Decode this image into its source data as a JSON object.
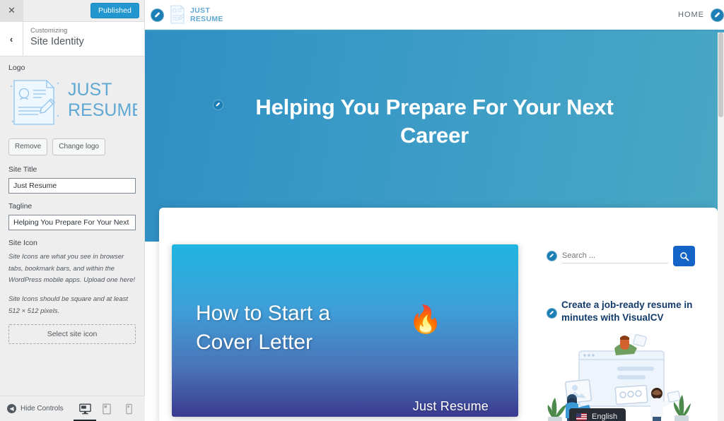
{
  "customizer": {
    "close_label": "✕",
    "publish_label": "Published",
    "back_label": "‹",
    "breadcrumb": "Customizing",
    "section_title": "Site Identity",
    "logo": {
      "label": "Logo",
      "alt_text": "JUST RESUME",
      "brand_line1": "JUST",
      "brand_line2": "RESUME",
      "remove_label": "Remove",
      "change_label": "Change logo"
    },
    "site_title": {
      "label": "Site Title",
      "value": "Just Resume",
      "placeholder": "Site Title"
    },
    "tagline": {
      "label": "Tagline",
      "value": "Helping You Prepare For Your Next Career",
      "placeholder": "Tagline"
    },
    "site_icon": {
      "label": "Site Icon",
      "description1": "Site Icons are what you see in browser tabs, bookmark bars, and within the WordPress mobile apps. Upload one here!",
      "description2": "Site Icons should be square and at least 512 × 512 pixels.",
      "select_label": "Select site icon"
    },
    "footer": {
      "hide_controls_label": "Hide Controls",
      "devices": [
        {
          "name": "desktop",
          "active": true
        },
        {
          "name": "tablet",
          "active": false
        },
        {
          "name": "mobile",
          "active": false
        }
      ]
    }
  },
  "preview": {
    "header": {
      "brand_line1": "JUST",
      "brand_line2": "RESUME",
      "nav": [
        {
          "label": "HOME"
        }
      ]
    },
    "hero": {
      "headline": "Helping You Prepare For Your Next Career"
    },
    "featured": {
      "title_line1": "How to Start a",
      "title_line2": "Cover Letter",
      "emoji": "🔥",
      "footer_text": "Just Resume"
    },
    "sidebar": {
      "search_placeholder": "Search ...",
      "search_value": "",
      "search_button_icon": "search-icon",
      "promo_heading": "Create a job-ready resume in minutes with VisualCV",
      "language": "English"
    }
  },
  "colors": {
    "wp_blue": "#2196cf",
    "hero_start": "#2f8fc4",
    "hero_end": "#4aa8c4",
    "brand_blue": "#5fa8d3",
    "search_button": "#1464c8",
    "heading_navy": "#123a6b",
    "edit_badge": "#1b7eb4"
  }
}
